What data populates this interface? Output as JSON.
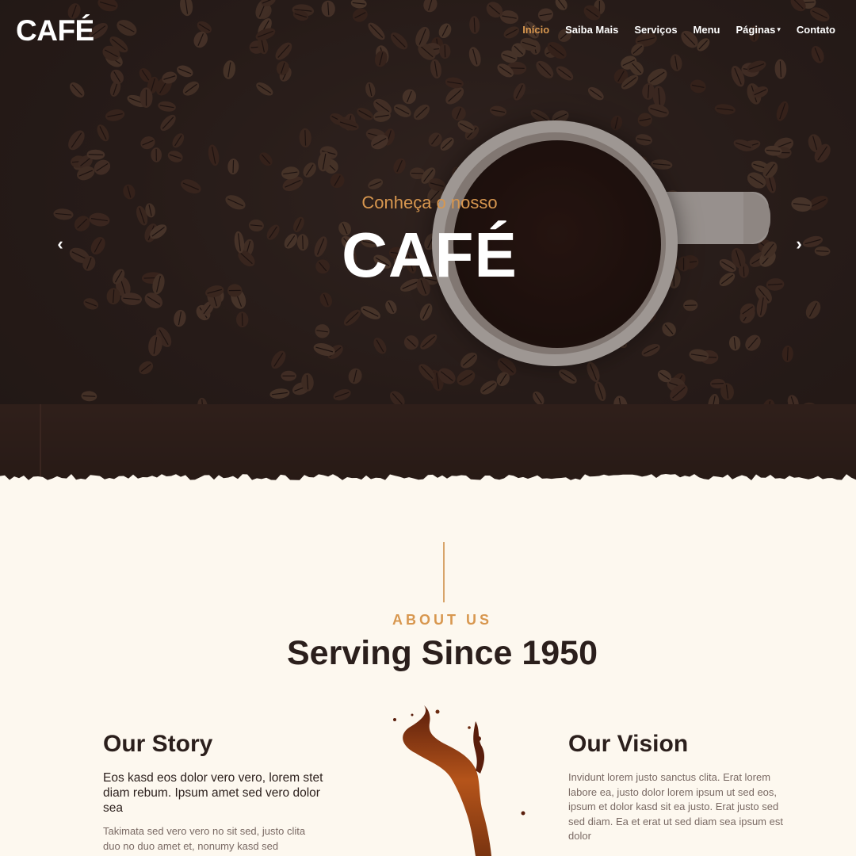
{
  "brand": {
    "logo": "CAFÉ",
    "accent_color": "#d8974f",
    "dark_color": "#2b1f1c",
    "cream_color": "#fdf8ef"
  },
  "nav": {
    "items": [
      {
        "label": "Início",
        "active": true
      },
      {
        "label": "Saiba Mais"
      },
      {
        "label": "Serviços"
      },
      {
        "label": "Menu"
      },
      {
        "label": "Páginas",
        "dropdown": true
      },
      {
        "label": "Contato"
      }
    ]
  },
  "hero": {
    "subtitle": "Conheça o nosso",
    "title": "CAFÉ",
    "prev_icon": "chevron-left-icon",
    "next_icon": "chevron-right-icon"
  },
  "about": {
    "eyebrow": "ABOUT US",
    "title": "Serving Since 1950",
    "story": {
      "title": "Our Story",
      "lead": "Eos kasd eos dolor vero vero, lorem stet diam rebum. Ipsum amet sed vero dolor sea",
      "body": "Takimata sed vero vero no sit sed, justo clita duo no duo amet et, nonumy kasd sed"
    },
    "vision": {
      "title": "Our Vision",
      "body": "Invidunt lorem justo sanctus clita. Erat lorem labore ea, justo dolor lorem ipsum ut sed eos, ipsum et dolor kasd sit ea justo. Erat justo sed sed diam. Ea et erat ut sed diam sea ipsum est dolor"
    }
  }
}
